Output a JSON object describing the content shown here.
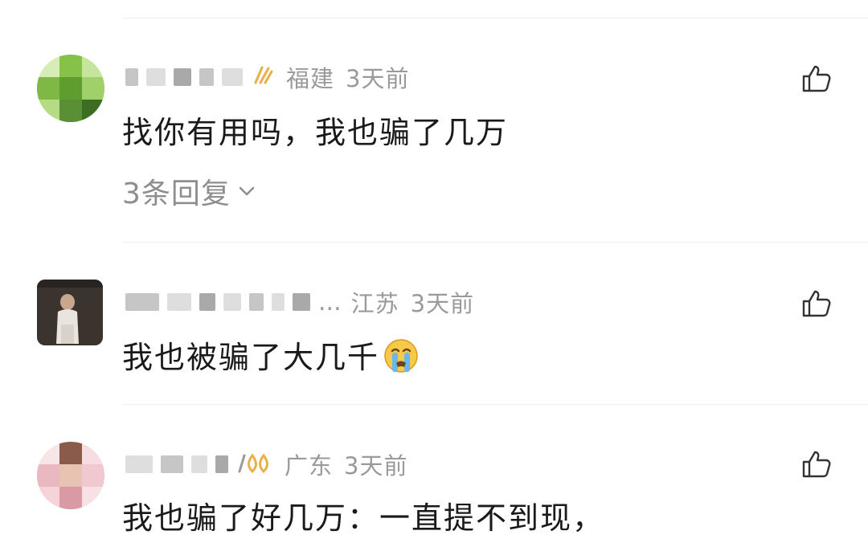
{
  "comments": [
    {
      "location": "福建",
      "time": "3天前",
      "text": "找你有用吗，我也骗了几万",
      "replies_label": "3条回复",
      "avatar_icon": "avatar-image-pixelated-green",
      "badge_icon": "gold-badge-icon"
    },
    {
      "name_visible": "...",
      "location": "江苏",
      "time": "3天前",
      "text": "我也被骗了大几千",
      "emoji_icon": "crying-face-emoji",
      "avatar_icon": "avatar-image-portrait"
    },
    {
      "location": "广东",
      "time": "3天前",
      "text": "我也骗了好几万：一直提不到现，",
      "avatar_icon": "avatar-image-pink",
      "badge_icon": "gold-badge-icon"
    }
  ],
  "colors": {
    "meta": "#9a9a9a",
    "text": "#1a1a1a",
    "replies": "#8e8e8e",
    "divider": "#eeeeee",
    "badge": "#e8b04a"
  }
}
